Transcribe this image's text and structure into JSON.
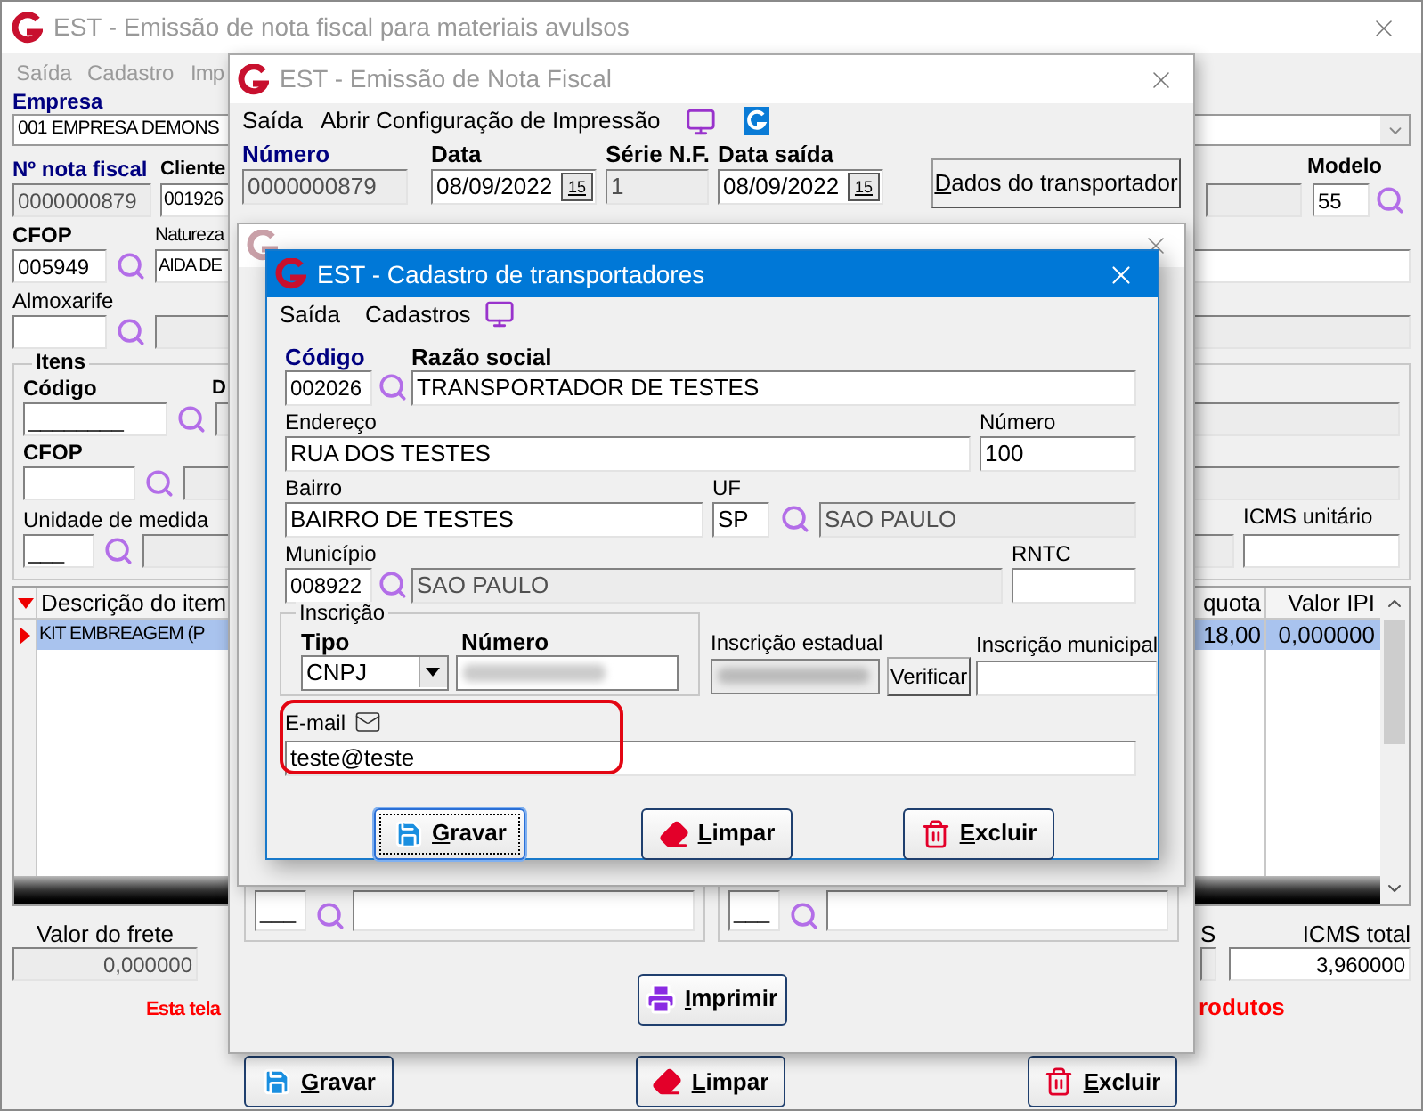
{
  "main_window": {
    "title": "EST - Emissão de nota fiscal para materiais avulsos",
    "menu": [
      "Saída",
      "Cadastro",
      "Imp"
    ],
    "empresa": {
      "label": "Empresa",
      "value": "001 EMPRESA DEMONS"
    },
    "nota_fiscal": {
      "label": "Nº nota fiscal",
      "value": "0000000879"
    },
    "cliente": {
      "label": "Cliente",
      "value": "001926"
    },
    "modelo": {
      "label": "Modelo",
      "value": "55"
    },
    "cfop": {
      "label": "CFOP",
      "value": "005949"
    },
    "natureza": {
      "label": "Natureza",
      "value": "AIDA DE"
    },
    "almoxarife": {
      "label": "Almoxarife"
    },
    "itens": {
      "title": "Itens",
      "codigo_label": "Código",
      "codigo_value": "________",
      "label_cut": "D",
      "cfop_label": "CFOP",
      "unidade_label": "Unidade de medida",
      "unidade_value": "___",
      "icms_unitario_label": "ICMS unitário"
    },
    "table": {
      "columns": [
        "Descrição do item",
        "quota",
        "Valor IPI"
      ],
      "rows": [
        {
          "cells": [
            "KIT EMBREAGEM (P",
            "18,00",
            "0,000000"
          ],
          "selected": true
        }
      ]
    },
    "valor_frete": {
      "label": "Valor do frete",
      "value": "0,000000"
    },
    "icms_total": {
      "label_cut": "S",
      "label": "ICMS total",
      "value": "3,960000"
    },
    "notice": [
      "Esta tela",
      "rodutos"
    ],
    "buttons": [
      {
        "label": "Gravar",
        "kind": "save"
      },
      {
        "label": "Limpar",
        "kind": "clear"
      },
      {
        "label": "Excluir",
        "kind": "delete"
      }
    ]
  },
  "nf_window": {
    "title": "EST - Emissão de Nota Fiscal",
    "menu": [
      "Saída",
      "Abrir Configuração de Impressão"
    ],
    "fields": [
      {
        "label": "Número",
        "value": "0000000879",
        "kind": "text",
        "disabled": true,
        "required": true
      },
      {
        "label": "Data",
        "value": "08/09/2022",
        "kind": "date",
        "button_text": "15",
        "disabled": false,
        "required": false
      },
      {
        "label": "Série N.F.",
        "value": "1",
        "kind": "text",
        "disabled": true,
        "required": false
      },
      {
        "label": "Data saída",
        "value": "08/09/2022",
        "kind": "date",
        "button_text": "15",
        "disabled": false,
        "required": false
      }
    ],
    "transport_button": "Dados do transportador",
    "operacao_fields": [
      "___",
      "___"
    ],
    "print_button": "Imprimir"
  },
  "cadastro_window": {
    "title": "EST - Cadastro de transportadores",
    "menu": [
      "Saída",
      "Cadastros"
    ],
    "codigo": {
      "label": "Código",
      "value": "002026"
    },
    "razao_social": {
      "label": "Razão social",
      "value": "TRANSPORTADOR DE TESTES"
    },
    "endereco": {
      "label": "Endereço",
      "value": "RUA DOS TESTES"
    },
    "numero": {
      "label": "Número",
      "value": "100"
    },
    "bairro": {
      "label": "Bairro",
      "value": "BAIRRO DE TESTES"
    },
    "uf": {
      "label": "UF",
      "value": "SP",
      "name": "SAO PAULO"
    },
    "municipio": {
      "label": "Município",
      "value": "008922",
      "name": "SAO PAULO"
    },
    "rntc": {
      "label": "RNTC"
    },
    "inscricao": {
      "title": "Inscrição",
      "tipo_label": "Tipo",
      "tipo_value": "CNPJ",
      "numero_label": "Número"
    },
    "inscricao_estadual": {
      "label": "Inscrição estadual",
      "button": "Verificar"
    },
    "inscricao_municipal": {
      "label": "Inscrição municipal"
    },
    "email": {
      "label": "E-mail",
      "value": "teste@teste",
      "highlighted": true
    },
    "buttons": [
      {
        "label": "Gravar",
        "kind": "save",
        "focused": true
      },
      {
        "label": "Limpar",
        "kind": "clear",
        "focused": false
      },
      {
        "label": "Excluir",
        "kind": "delete",
        "focused": false
      }
    ]
  }
}
